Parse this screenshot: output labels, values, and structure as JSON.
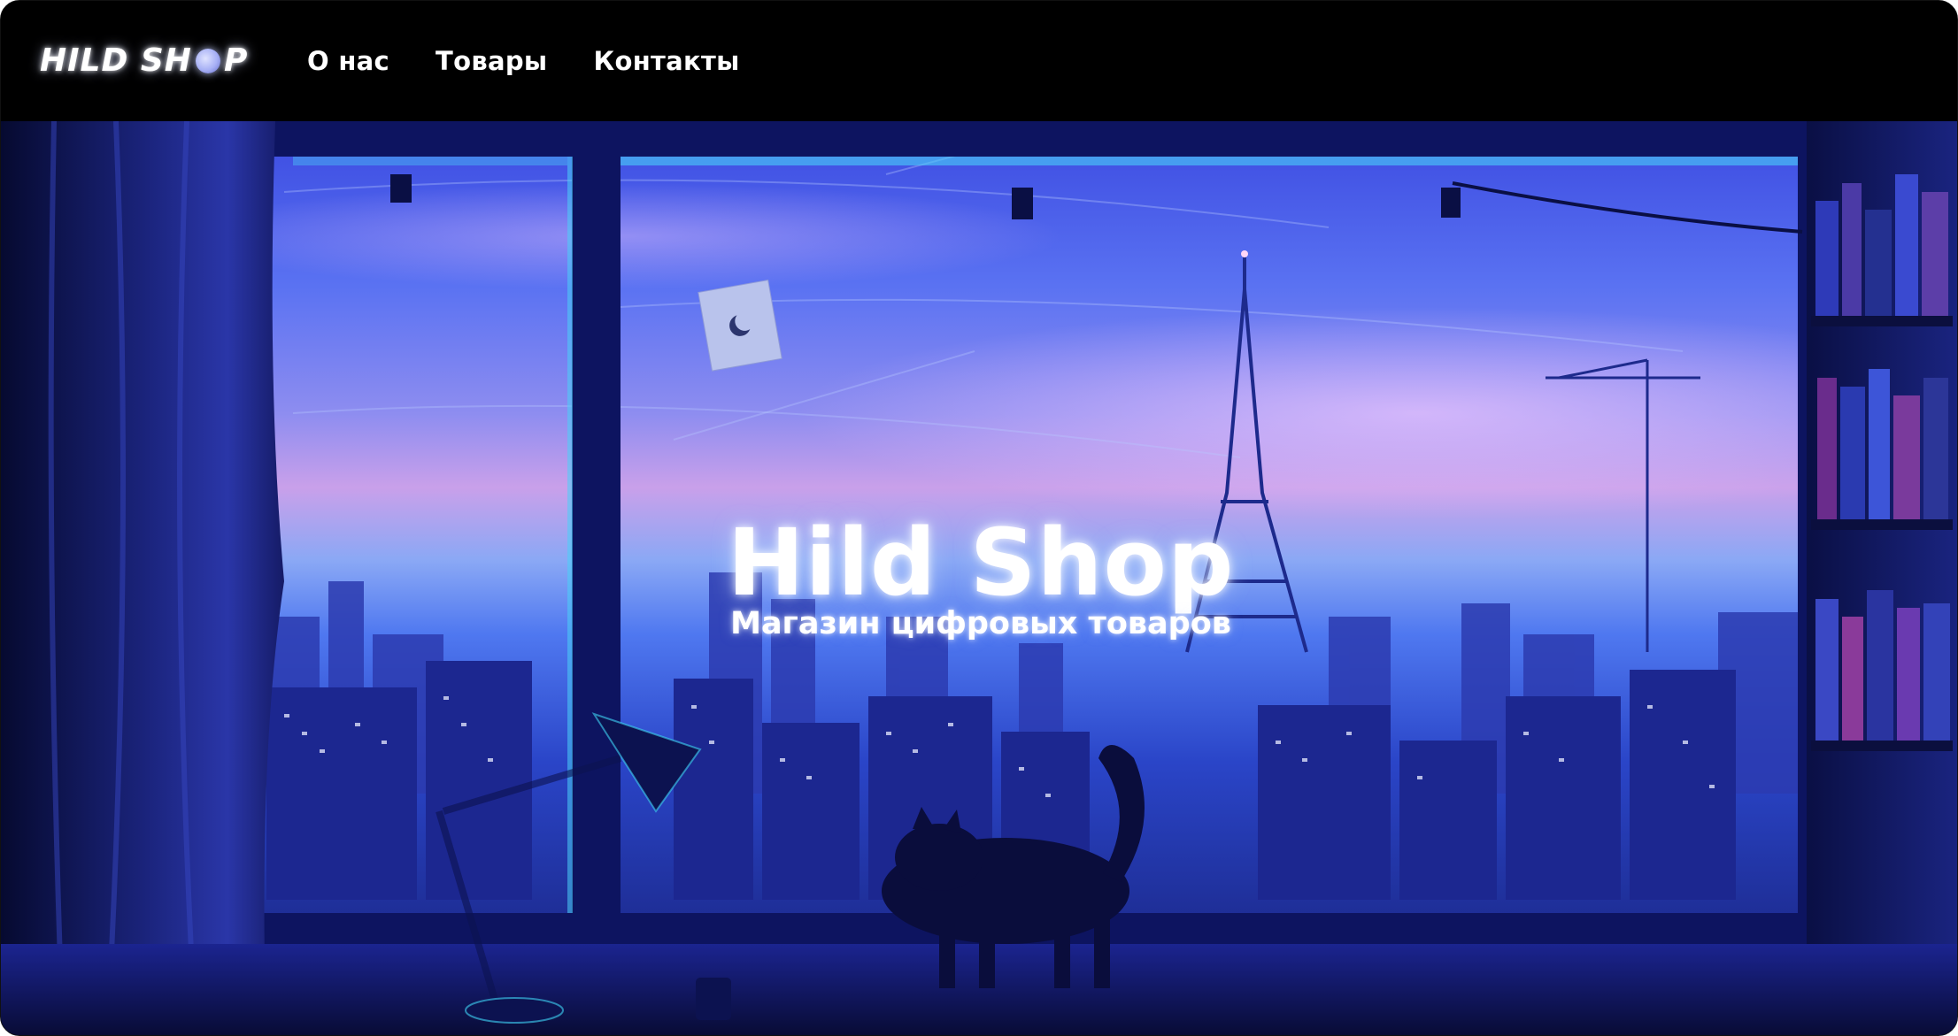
{
  "header": {
    "logo": {
      "part1": "HILD SH",
      "part2": "P"
    },
    "nav": [
      {
        "label": "О нас"
      },
      {
        "label": "Товары"
      },
      {
        "label": "Контакты"
      }
    ]
  },
  "hero": {
    "title": "Hild Shop",
    "subtitle": "Магазин цифровых товаров"
  },
  "colors": {
    "header_bg": "#000000",
    "text": "#ffffff",
    "sky_top": "#2b3bd8",
    "sky_pink": "#d89ae8",
    "city_dark": "#141a5c"
  }
}
